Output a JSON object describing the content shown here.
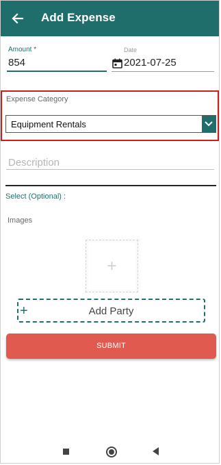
{
  "header": {
    "title": "Add Expense",
    "back_icon": "arrow-left-icon"
  },
  "form": {
    "amount": {
      "label": "Amount *",
      "value": "854"
    },
    "date": {
      "label": "Date",
      "value": "2021-07-25",
      "icon": "calendar-icon"
    },
    "category": {
      "label": "Expense Category",
      "selected": "Equipment Rentals",
      "icon": "chevron-down-icon"
    },
    "description": {
      "placeholder": "Description",
      "value": ""
    },
    "select_optional_label": "Select (Optional) :",
    "images_label": "Images",
    "add_image_symbol": "+",
    "add_party": {
      "symbol": "+",
      "label": "Add Party"
    },
    "submit_label": "SUBMIT"
  },
  "nav": {
    "recent_icon": "square-icon",
    "home_icon": "circle-icon",
    "back_icon": "triangle-back-icon"
  },
  "colors": {
    "primary": "#1f6e6b",
    "highlight": "#d11a1a",
    "submit": "#e05a4f"
  }
}
